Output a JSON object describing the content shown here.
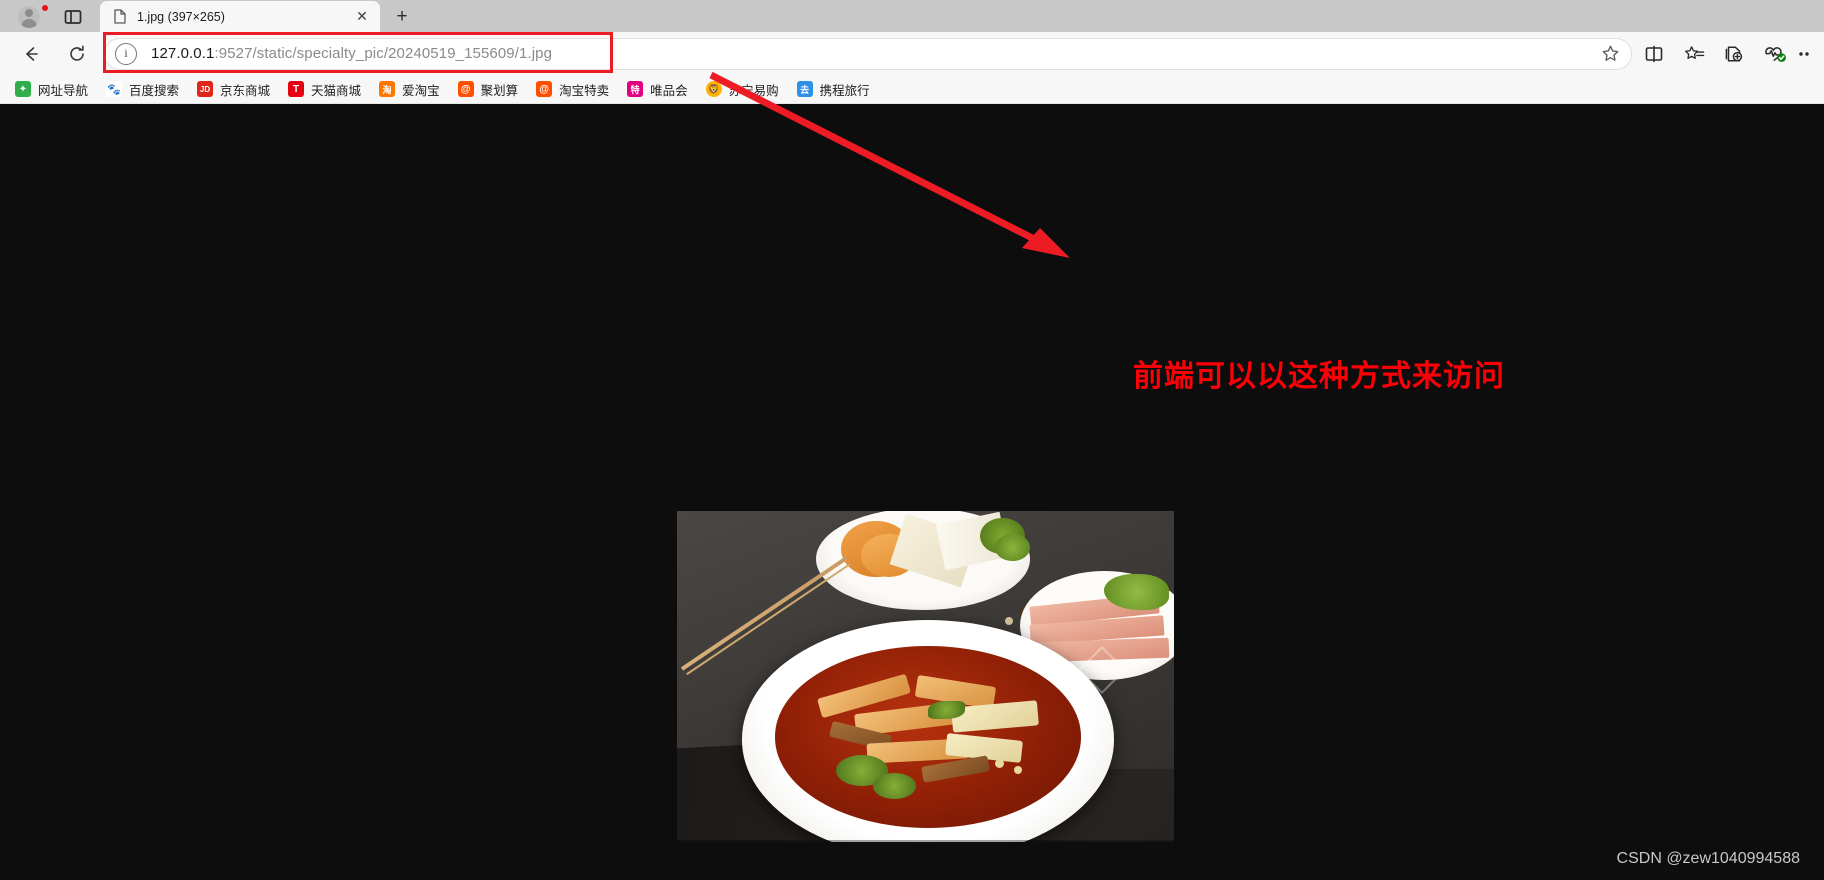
{
  "window": {
    "tab_strip": {
      "profile_icon": "profile-avatar-icon",
      "tab_actions_icon": "tab-actions-menu-icon",
      "tabs": [
        {
          "title": "1.jpg (397×265)",
          "favicon": "document-icon",
          "close_label": "✕",
          "active": true
        }
      ],
      "new_tab_label": "+"
    },
    "toolbar": {
      "back_label": "←",
      "reload_label": "⟳",
      "url_host": "127.0.0.1",
      "url_path": ":9527/static/specialty_pic/20240519_155609/1.jpg",
      "url_full": "127.0.0.1:9527/static/specialty_pic/20240519_155609/1.jpg",
      "info_icon_glyph": "i",
      "right_icons": [
        {
          "name": "favorite-star-icon",
          "glyph": "star"
        },
        {
          "name": "split-screen-icon",
          "glyph": "split"
        },
        {
          "name": "favorites-list-icon",
          "glyph": "star-list"
        },
        {
          "name": "collections-icon",
          "glyph": "collections"
        },
        {
          "name": "browser-essentials-icon",
          "glyph": "heartbeat-check"
        },
        {
          "name": "settings-more-icon",
          "glyph": "ellipsis"
        }
      ]
    },
    "bookmarks_bar": [
      {
        "label": "网址导航",
        "icon": "navigation-site-icon",
        "color": "#2fae4b",
        "mark": "✦"
      },
      {
        "label": "百度搜索",
        "icon": "baidu-icon",
        "color": "#ffffff",
        "mark": "熊"
      },
      {
        "label": "京东商城",
        "icon": "jd-icon",
        "color": "#e1251b",
        "mark": "JD"
      },
      {
        "label": "天猫商城",
        "icon": "tmall-icon",
        "color": "#e60012",
        "mark": "T"
      },
      {
        "label": "爱淘宝",
        "icon": "taobao-icon",
        "color": "#ff7700",
        "mark": "淘"
      },
      {
        "label": "聚划算",
        "icon": "juhuasuan-icon",
        "color": "#ff5000",
        "mark": "@"
      },
      {
        "label": "淘宝特卖",
        "icon": "taobao-sale-icon",
        "color": "#ff5000",
        "mark": "@"
      },
      {
        "label": "唯品会",
        "icon": "vip-icon",
        "color": "#e4007f",
        "mark": "特"
      },
      {
        "label": "苏宁易购",
        "icon": "suning-icon",
        "color": "#ffb400",
        "mark": "狮"
      },
      {
        "label": "携程旅行",
        "icon": "ctrip-icon",
        "color": "#2f90e8",
        "mark": "去"
      }
    ]
  },
  "page": {
    "background_color": "#0d0d0d",
    "image": {
      "name": "1.jpg",
      "alt": "spicy hotpot dish photo",
      "natural_size": "397×265"
    },
    "annotation": {
      "text": "前端可以以这种方式来访问",
      "color": "#fb0007",
      "arrow_color": "#ed1c24",
      "highlight_box_color": "#ed1c24"
    },
    "watermark": "CSDN @zew1040994588"
  }
}
